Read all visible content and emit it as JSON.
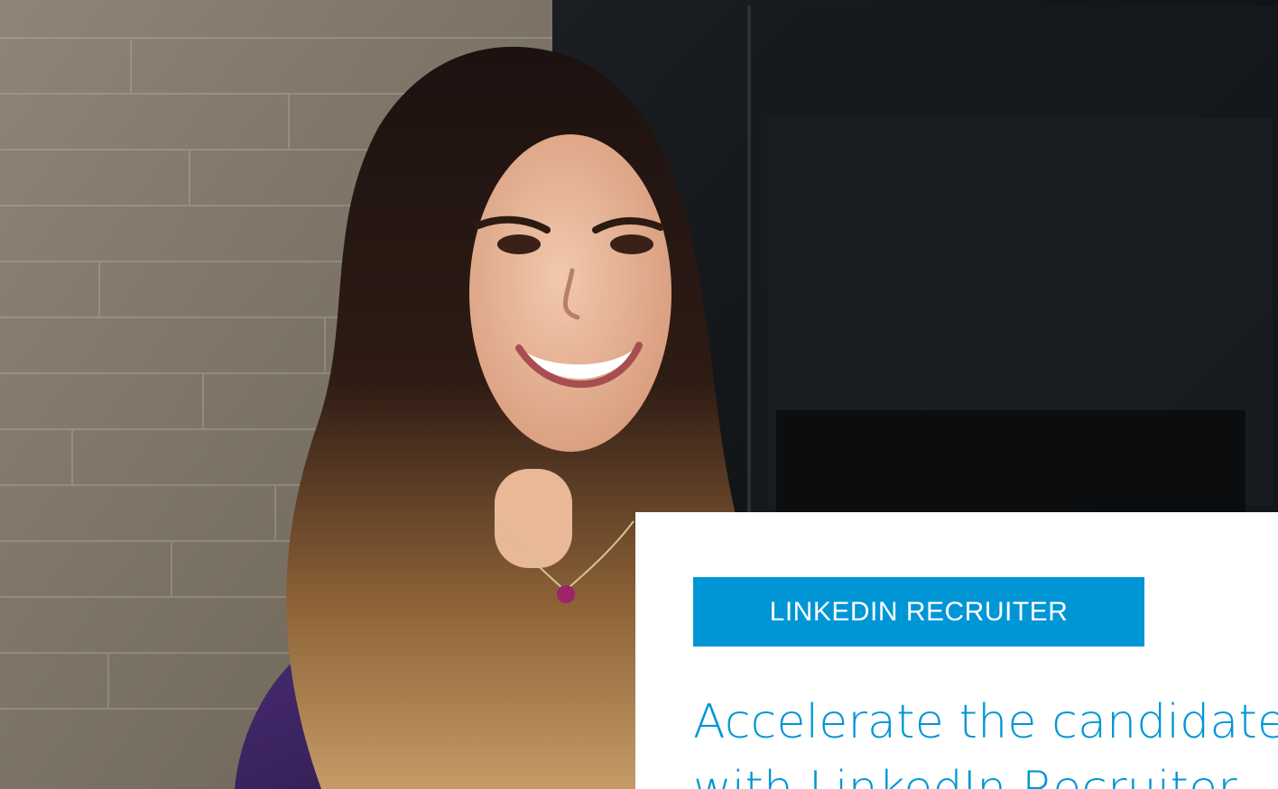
{
  "hero": {
    "image_label": "Smiling woman with long wavy hair"
  },
  "card": {
    "badge_label": "LINKEDIN RECRUITER",
    "headline": "Accelerate the candidate journey with LinkedIn Recruiter"
  },
  "colors": {
    "accent": "#0096d6",
    "card_background": "#ffffff",
    "wall": "#7a7164",
    "dark_room": "#111417",
    "shirt": "#3c2660"
  }
}
